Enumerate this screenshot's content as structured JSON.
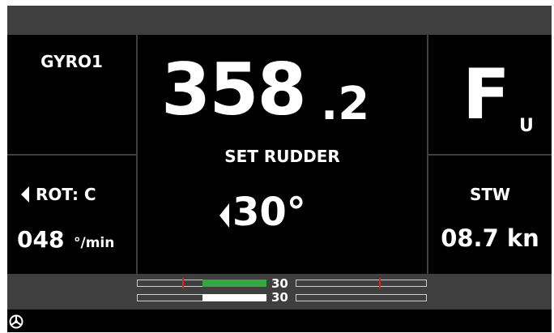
{
  "left_panel": {
    "heading_source": "GYRO1",
    "rot_label": "ROT: C",
    "rot_value": "048",
    "rot_unit": "°/min"
  },
  "center_panel": {
    "heading_main": "358",
    "heading_decimal": ".2",
    "set_rudder_label": "SET RUDDER",
    "set_rudder_value": "30°"
  },
  "right_panel": {
    "mode_letter": "F",
    "mode_sub": "U",
    "stw_label": "STW",
    "stw_value": "08.7 kn"
  },
  "rudder_bars": {
    "top_label": "30",
    "bottom_label": "30",
    "top_value": "30",
    "bottom_value": "30"
  },
  "colors": {
    "frame_bg": "#000000",
    "divider": "#3f3f3f",
    "green_fill": "#35a845",
    "white_fill": "#ffffff",
    "red_marker": "#e0201b"
  },
  "icons": {
    "status": "steering-wheel-icon",
    "rot_direction": "left-triangle-icon",
    "rudder_direction": "left-triangle-icon"
  }
}
